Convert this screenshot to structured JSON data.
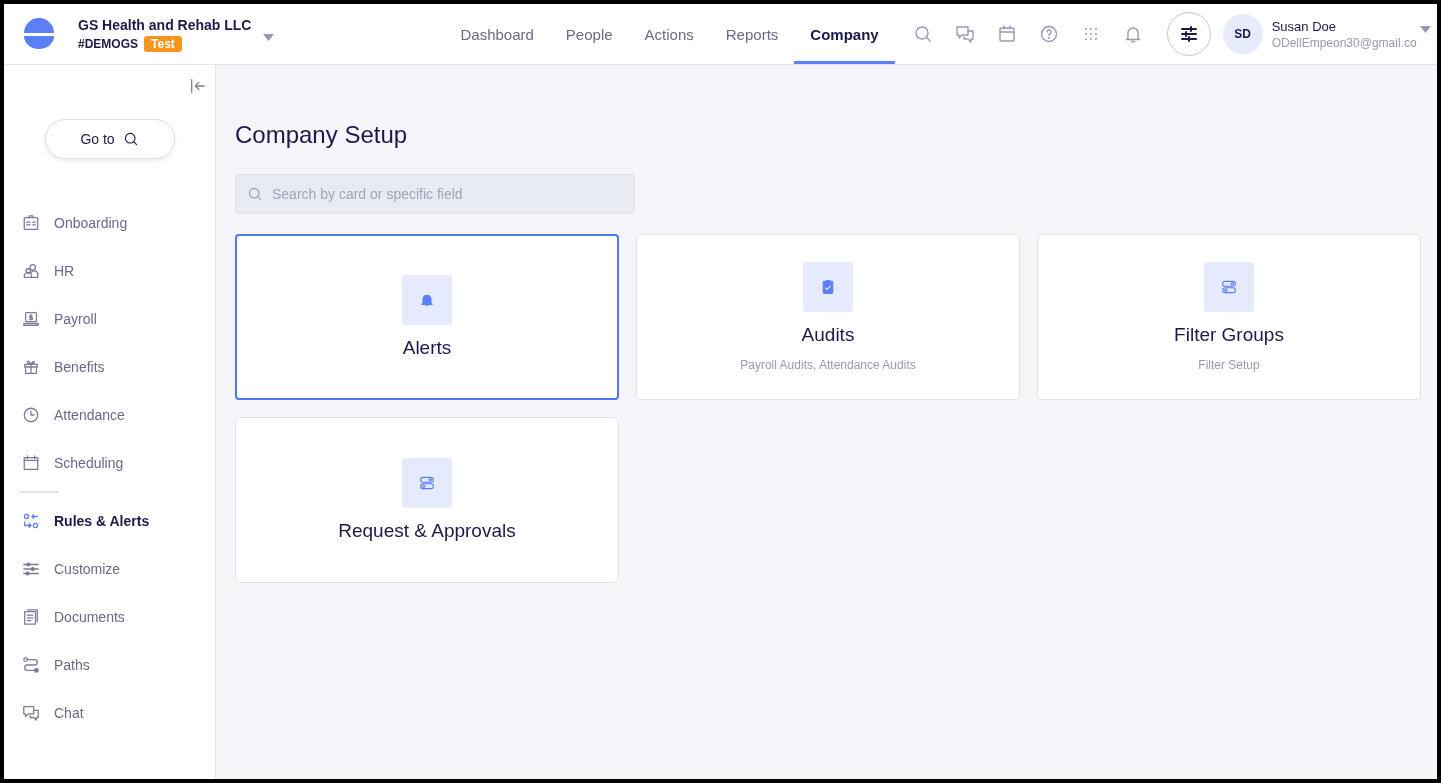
{
  "header": {
    "company": "GS Health and Rehab LLC",
    "code": "#DEMOGS",
    "badge": "Test",
    "nav": [
      {
        "label": "Dashboard",
        "selected": false
      },
      {
        "label": "People",
        "selected": false
      },
      {
        "label": "Actions",
        "selected": false
      },
      {
        "label": "Reports",
        "selected": false
      },
      {
        "label": "Company",
        "selected": true
      }
    ],
    "tools": [
      {
        "kind": "search"
      },
      {
        "kind": "chat"
      },
      {
        "kind": "calendar"
      },
      {
        "kind": "help"
      },
      {
        "kind": "apps"
      },
      {
        "kind": "bell"
      }
    ],
    "user": {
      "initials": "SD",
      "name": "Susan Doe",
      "email": "ODellEmpeon30@gmail.co"
    }
  },
  "sidebar": {
    "goto": "Go to",
    "groups": [
      [
        {
          "label": "Onboarding",
          "kind": "badge",
          "selected": false
        },
        {
          "label": "HR",
          "kind": "people",
          "selected": false
        },
        {
          "label": "Payroll",
          "kind": "payroll",
          "selected": false
        },
        {
          "label": "Benefits",
          "kind": "gift",
          "selected": false
        },
        {
          "label": "Attendance",
          "kind": "clock",
          "selected": false
        },
        {
          "label": "Scheduling",
          "kind": "calendar",
          "selected": false
        }
      ],
      [
        {
          "label": "Rules & Alerts",
          "kind": "rules",
          "selected": true
        },
        {
          "label": "Customize",
          "kind": "sliders",
          "selected": false
        },
        {
          "label": "Documents",
          "kind": "doc",
          "selected": false
        },
        {
          "label": "Paths",
          "kind": "path",
          "selected": false
        },
        {
          "label": "Chat",
          "kind": "chat",
          "selected": false
        }
      ]
    ]
  },
  "main": {
    "title": "Company Setup",
    "search": {
      "placeholder": "Search by card or specific field"
    },
    "cards": [
      {
        "title": "Alerts",
        "kind": "bell",
        "selected": true
      },
      {
        "title": "Audits",
        "subtitle": "Payroll Audits, Attendance Audits",
        "kind": "clipboard",
        "selected": false
      },
      {
        "title": "Filter Groups",
        "subtitle": "Filter Setup",
        "kind": "toggles",
        "selected": false
      },
      {
        "title": "Request & Approvals",
        "kind": "toggles",
        "selected": false
      }
    ]
  }
}
